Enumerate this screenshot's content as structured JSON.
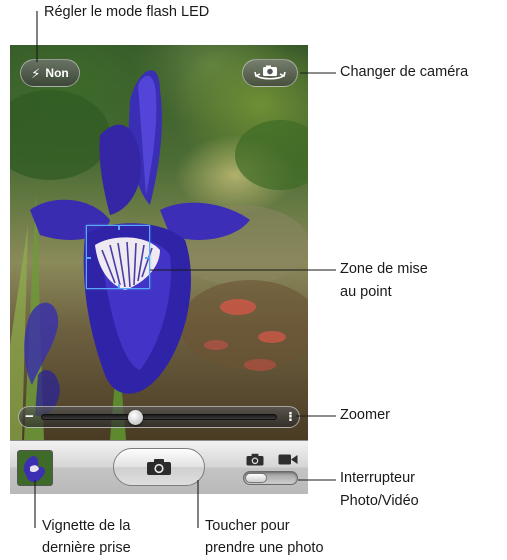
{
  "camera": {
    "flash_label": "Non",
    "zoom": 0.39,
    "mode": "photo"
  },
  "icons": {
    "flash": "lightning-bolt-icon",
    "switch_camera": "camera-rotate-icon",
    "shutter": "camera-icon",
    "photo_mode": "camera-icon",
    "video_mode": "video-camera-icon"
  },
  "colors": {
    "focus_box": "#5aa9ff",
    "toolbar_top": "#f2f2f2",
    "toolbar_bottom": "#b9b9b9"
  },
  "callouts": {
    "flash": "Régler le mode flash LED",
    "switch_camera": "Changer de caméra",
    "focus_line1": "Zone de mise",
    "focus_line2": "au point",
    "zoom": "Zoomer",
    "switch_line1": "Interrupteur",
    "switch_line2": "Photo/Vidéo",
    "thumbnail_line1": "Vignette de la",
    "thumbnail_line2": "dernière prise",
    "shutter_line1": "Toucher pour",
    "shutter_line2": "prendre une photo"
  }
}
